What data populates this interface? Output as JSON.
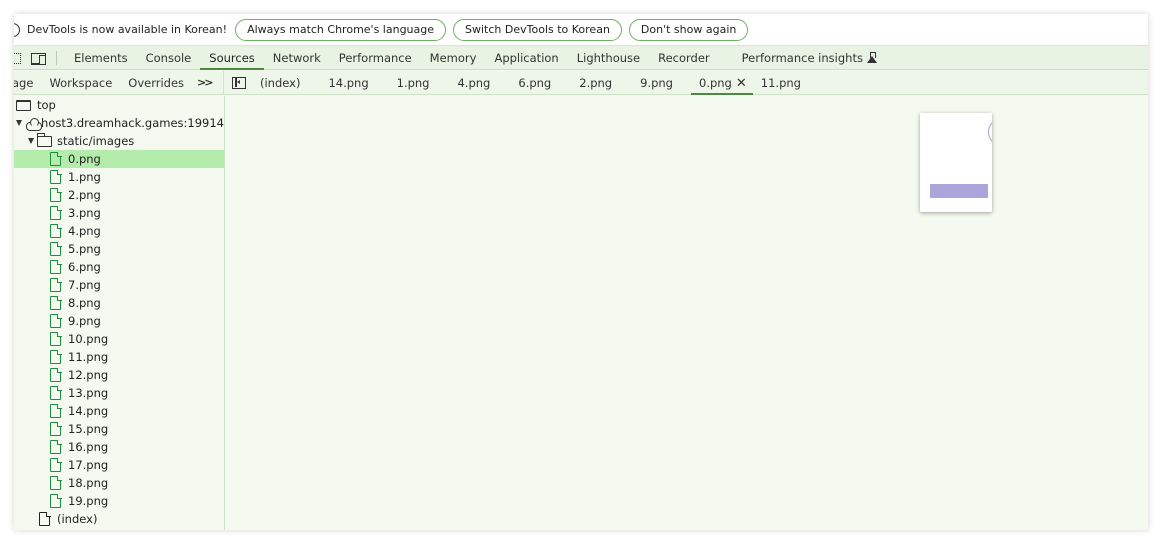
{
  "infobar": {
    "message": "DevTools is now available in Korean!",
    "buttons": [
      "Always match Chrome's language",
      "Switch DevTools to Korean",
      "Don't show again"
    ]
  },
  "main_tabs": [
    "Elements",
    "Console",
    "Sources",
    "Network",
    "Performance",
    "Memory",
    "Application",
    "Lighthouse",
    "Recorder",
    "Performance insights"
  ],
  "active_main_tab": "Sources",
  "navigator_tabs": [
    "age",
    "Workspace",
    "Overrides"
  ],
  "more_tabs_label": ">>",
  "file_tabs": [
    "(index)",
    "14.png",
    "1.png",
    "4.png",
    "6.png",
    "2.png",
    "9.png",
    "0.png",
    "11.png"
  ],
  "active_file_tab": "0.png",
  "close_glyph": "✕",
  "tree": {
    "top": "top",
    "host": "host3.dreamhack.games:19914",
    "folder": "static/images",
    "files": [
      "0.png",
      "1.png",
      "2.png",
      "3.png",
      "4.png",
      "5.png",
      "6.png",
      "7.png",
      "8.png",
      "9.png",
      "10.png",
      "11.png",
      "12.png",
      "13.png",
      "14.png",
      "15.png",
      "16.png",
      "17.png",
      "18.png",
      "19.png"
    ],
    "selected_file": "0.png",
    "index": "(index)"
  },
  "colors": {
    "accent": "#4b8a3f",
    "selected_row": "#b3ecab",
    "panel_bg": "#f4faef",
    "image_bar": "#aaa6dc"
  }
}
